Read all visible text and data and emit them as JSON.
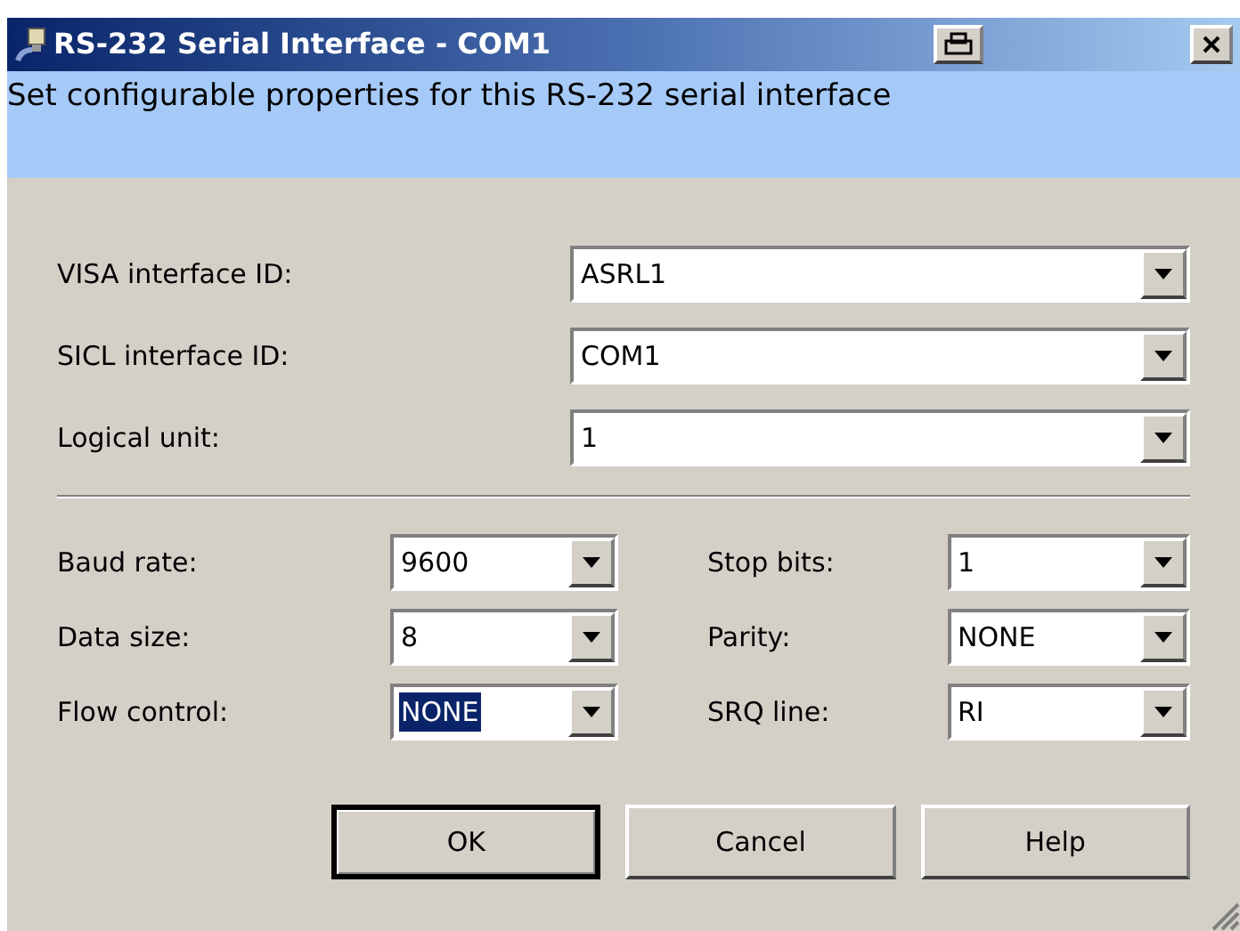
{
  "window": {
    "title": "RS-232 Serial Interface - COM1"
  },
  "banner": {
    "text": "Set configurable properties for this RS-232 serial interface"
  },
  "interface_fields": [
    {
      "label": "VISA interface ID:",
      "value": "ASRL1",
      "highlighted": false
    },
    {
      "label": "SICL interface ID:",
      "value": "COM1",
      "highlighted": false
    },
    {
      "label": "Logical unit:",
      "value": "1",
      "highlighted": false
    }
  ],
  "serial_fields": [
    {
      "label": "Baud rate:",
      "value": "9600",
      "highlighted": false
    },
    {
      "label": "Stop bits:",
      "value": "1",
      "highlighted": false
    },
    {
      "label": "Data size:",
      "value": "8",
      "highlighted": false
    },
    {
      "label": "Parity:",
      "value": "NONE",
      "highlighted": false
    },
    {
      "label": "Flow control:",
      "value": "NONE",
      "highlighted": true
    },
    {
      "label": "SRQ line:",
      "value": "RI",
      "highlighted": false
    }
  ],
  "buttons": [
    {
      "label": "OK",
      "default": true
    },
    {
      "label": "Cancel",
      "default": false
    },
    {
      "label": "Help",
      "default": false
    }
  ]
}
